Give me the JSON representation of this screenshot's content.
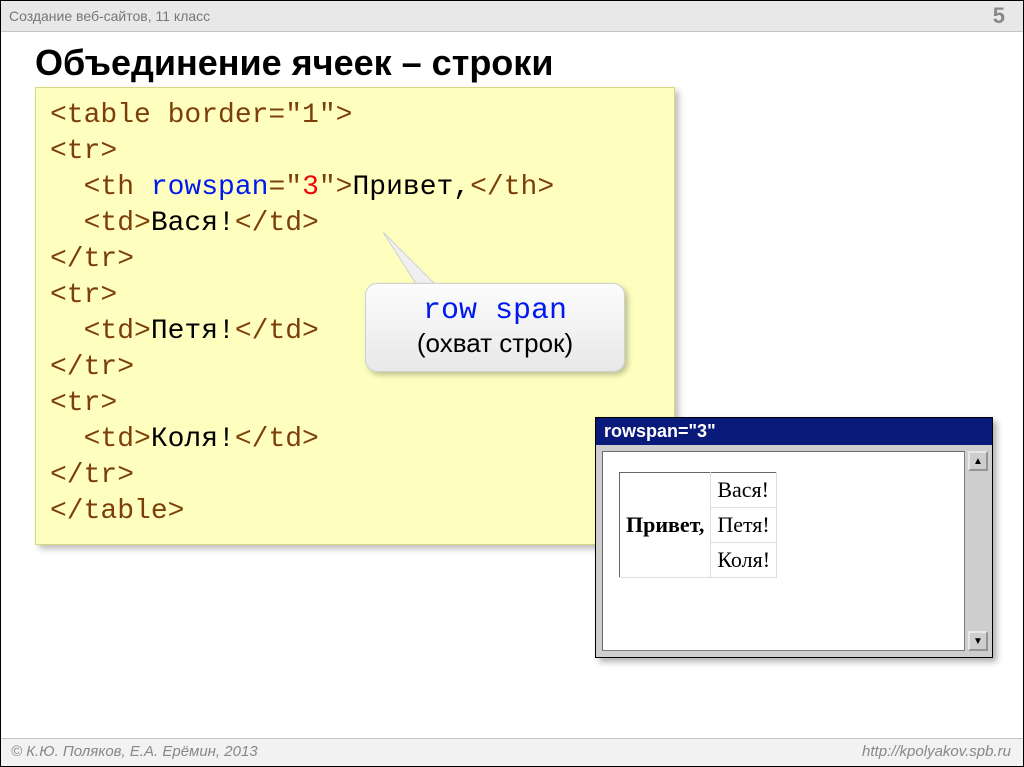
{
  "header": {
    "course": "Создание веб-сайтов, 11 класс",
    "page": "5"
  },
  "title": "Объединение ячеек – строки",
  "code": {
    "l1a": "<table border=\"1\">",
    "l2": "<tr>",
    "l3pre": "  <th ",
    "l3attr": "rowspan",
    "l3eq": "=\"",
    "l3val": "3",
    "l3post": "\">",
    "l3txt": "Привет,",
    "l3close": "</th>",
    "l4a": "  <td>",
    "l4txt": "Вася!",
    "l4b": "</td>",
    "l5": "</tr>",
    "l6": "<tr>",
    "l7a": "  <td>",
    "l7txt": "Петя!",
    "l7b": "</td>",
    "l8": "</tr>",
    "l9": "<tr>",
    "l10a": "  <td>",
    "l10txt": "Коля!",
    "l10b": "</td>",
    "l11": "</tr>",
    "l12": "</table>"
  },
  "callout": {
    "code": "row span",
    "text": "(охват строк)"
  },
  "window": {
    "title": "rowspan=\"3\"",
    "th": "Привет,",
    "td1": "Вася!",
    "td2": "Петя!",
    "td3": "Коля!"
  },
  "footer": {
    "copyright": "© К.Ю. Поляков, Е.А. Ерёмин, 2013",
    "url": "http://kpolyakov.spb.ru"
  }
}
